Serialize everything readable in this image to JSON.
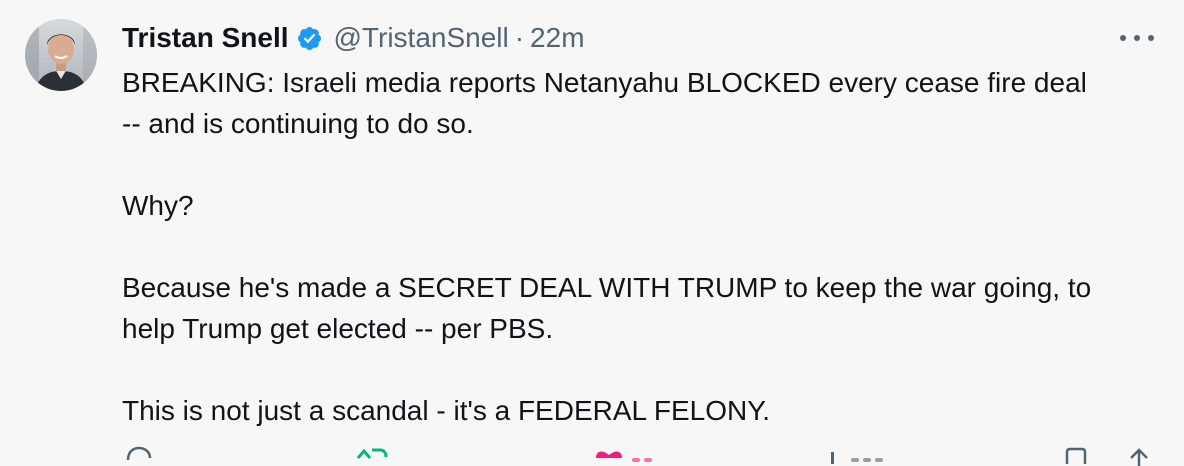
{
  "tweet": {
    "author_name": "Tristan Snell",
    "handle": "@TristanSnell",
    "separator": "·",
    "time": "22m",
    "paragraphs": [
      {
        "lines": [
          "BREAKING: Israeli media reports Netanyahu BLOCKED every cease fire deal",
          "-- and is continuing to do so."
        ]
      },
      {
        "lines": [
          "Why?"
        ]
      },
      {
        "lines": [
          "Because he's made a SECRET DEAL WITH TRUMP to keep the war going, to",
          "help Trump get elected -- per PBS."
        ]
      },
      {
        "lines": [
          "This is not just a scandal - it's a FEDERAL FELONY."
        ]
      }
    ]
  },
  "icons": {
    "verified": "verified-badge-icon",
    "more": "more-options-icon",
    "reply": "reply-icon",
    "repost": "repost-icon",
    "like": "like-icon",
    "views": "views-icon",
    "bookmark": "bookmark-icon",
    "share": "share-icon"
  },
  "colors": {
    "background": "#f7f7f7",
    "text": "#0f1419",
    "secondary": "#536471",
    "verified_blue": "#1d9bf0",
    "repost_green": "#00ba7c",
    "like_pink": "#f91880"
  }
}
